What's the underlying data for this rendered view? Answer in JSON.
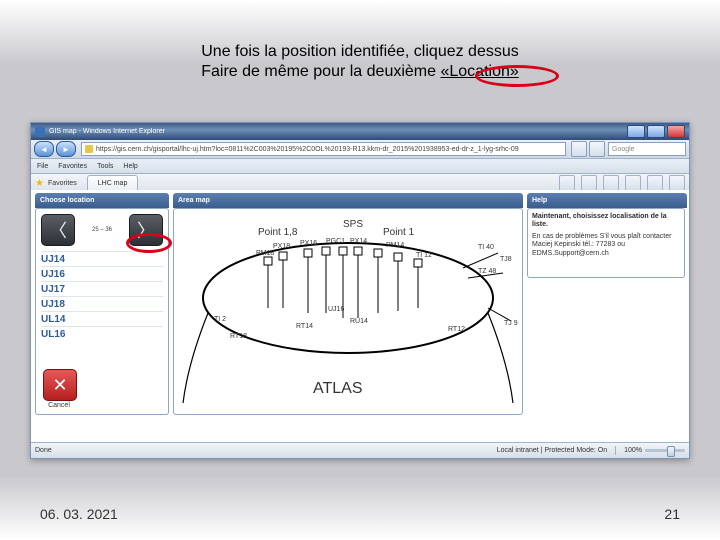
{
  "caption": {
    "line1": "Une fois la position identifiée, cliquez dessus",
    "line2_prefix": "Faire de même pour la deuxième ",
    "keyword": "«Location»"
  },
  "browser": {
    "title": "GIS map - Windows Internet Explorer",
    "url": "https://gis.cern.ch/gisportal/lhc-uj.htm?loc=0811%2C003%20195%2C0OL%20193-R13.kkm-dr_2015%201938953-ed-dr-z_1-lyg-srhc-09",
    "search_placeholder": "Google",
    "menu": [
      "File",
      "Favorites",
      "Tools",
      "Help"
    ],
    "favorites_label": "Favorites",
    "tab_label": "LHC map",
    "status": {
      "done": "Done",
      "zone": "Local intranet | Protected Mode: On",
      "zoom": "100%"
    }
  },
  "panels": {
    "choose": "Choose location",
    "area": "Area map",
    "help": "Help"
  },
  "location": {
    "range": "25 – 36",
    "items": [
      "UJ14",
      "UJ16",
      "UJ17",
      "UJ18",
      "UL14",
      "UL16"
    ],
    "cancel": "Cancel"
  },
  "help": {
    "headline": "Maintenant, choisissez localisation de la liste.",
    "contact": "En cas de problèmes S'il vous plaît contacter Maciej Kepinski tél.: 77283 ou EDMS.Support@cern.ch"
  },
  "map": {
    "title_top_left": "Point 1,8",
    "title_top_mid": "SPS",
    "title_top_right": "Point 1",
    "bottom_label": "ATLAS",
    "labels_small": [
      "TI 2",
      "PM18",
      "PX18",
      "RT18",
      "RT14",
      "PX16",
      "PGC1",
      "PX14",
      "RU14",
      "PM14",
      "TI 12",
      "RT12",
      "TI 40",
      "TZ 48",
      "TJ8",
      "TJ 9",
      "UJ16"
    ]
  },
  "footer": {
    "date": "06. 03. 2021",
    "page": "21"
  }
}
